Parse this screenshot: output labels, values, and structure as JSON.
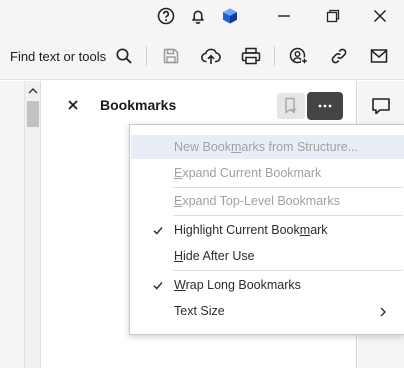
{
  "titlebar": {
    "icons": [
      "help-icon",
      "notification-bell-icon",
      "app-logo-icon",
      "minimize-icon",
      "restore-icon",
      "close-icon"
    ]
  },
  "toolbar": {
    "find_label": "Find text or tools",
    "tools": [
      "search-icon",
      "save-icon",
      "upload-icon",
      "print-icon",
      "share-user-icon",
      "link-icon",
      "email-icon"
    ]
  },
  "bookmarks": {
    "title": "Bookmarks"
  },
  "menu": {
    "items": [
      {
        "pre": "New Book",
        "u": "m",
        "post": "arks from Structure...",
        "disabled": true,
        "checked": false
      },
      {
        "pre": "",
        "u": "E",
        "post": "xpand Current Bookmark",
        "disabled": true,
        "checked": false
      },
      {
        "pre": "",
        "u": "E",
        "post": "xpand Top-Level Bookmarks",
        "disabled": true,
        "checked": false
      },
      {
        "pre": "Highlight Current Book",
        "u": "m",
        "post": "ark",
        "disabled": false,
        "checked": true
      },
      {
        "pre": "",
        "u": "H",
        "post": "ide After Use",
        "disabled": false,
        "checked": false
      },
      {
        "pre": "",
        "u": "W",
        "post": "rap Long Bookmarks",
        "disabled": false,
        "checked": true
      },
      {
        "pre": "Text Size",
        "u": "",
        "post": "",
        "disabled": false,
        "checked": false,
        "submenu": true
      }
    ]
  },
  "colors": {
    "more_button_bg": "#444444",
    "disabled_text": "#a0a0a0",
    "hover_row": "#e9eef6",
    "logo_blue": "#1f5fd6"
  }
}
